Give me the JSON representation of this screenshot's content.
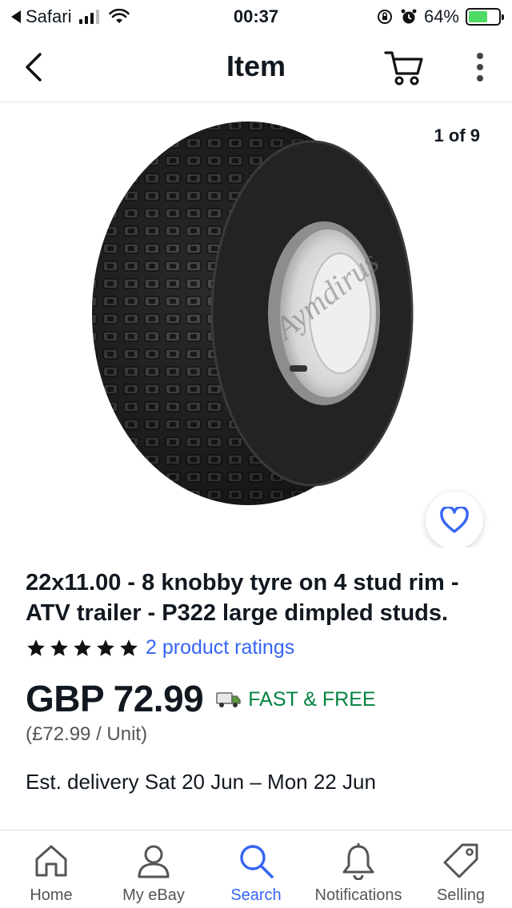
{
  "status_bar": {
    "back_app": "Safari",
    "time": "00:37",
    "battery_percent": "64%"
  },
  "header": {
    "title": "Item"
  },
  "gallery": {
    "counter": "1 of 9",
    "watermark": "Aymdirus"
  },
  "listing": {
    "title": "22x11.00 - 8 knobby tyre on 4 stud rim - ATV trailer - P322 large dimpled studs.",
    "rating_stars": 5,
    "ratings_link": "2 product ratings",
    "price": "GBP 72.99",
    "shipping": "FAST & FREE",
    "unit_price": "(£72.99 / Unit)",
    "delivery": "Est. delivery Sat 20 Jun – Mon 22 Jun"
  },
  "tab_bar": {
    "items": [
      {
        "label": "Home",
        "icon": "home-icon"
      },
      {
        "label": "My eBay",
        "icon": "person-icon"
      },
      {
        "label": "Search",
        "icon": "search-icon"
      },
      {
        "label": "Notifications",
        "icon": "bell-icon"
      },
      {
        "label": "Selling",
        "icon": "tag-icon"
      }
    ],
    "active": "Search"
  },
  "colors": {
    "link": "#3665f3",
    "shipping": "#05823f",
    "text": "#111820"
  }
}
